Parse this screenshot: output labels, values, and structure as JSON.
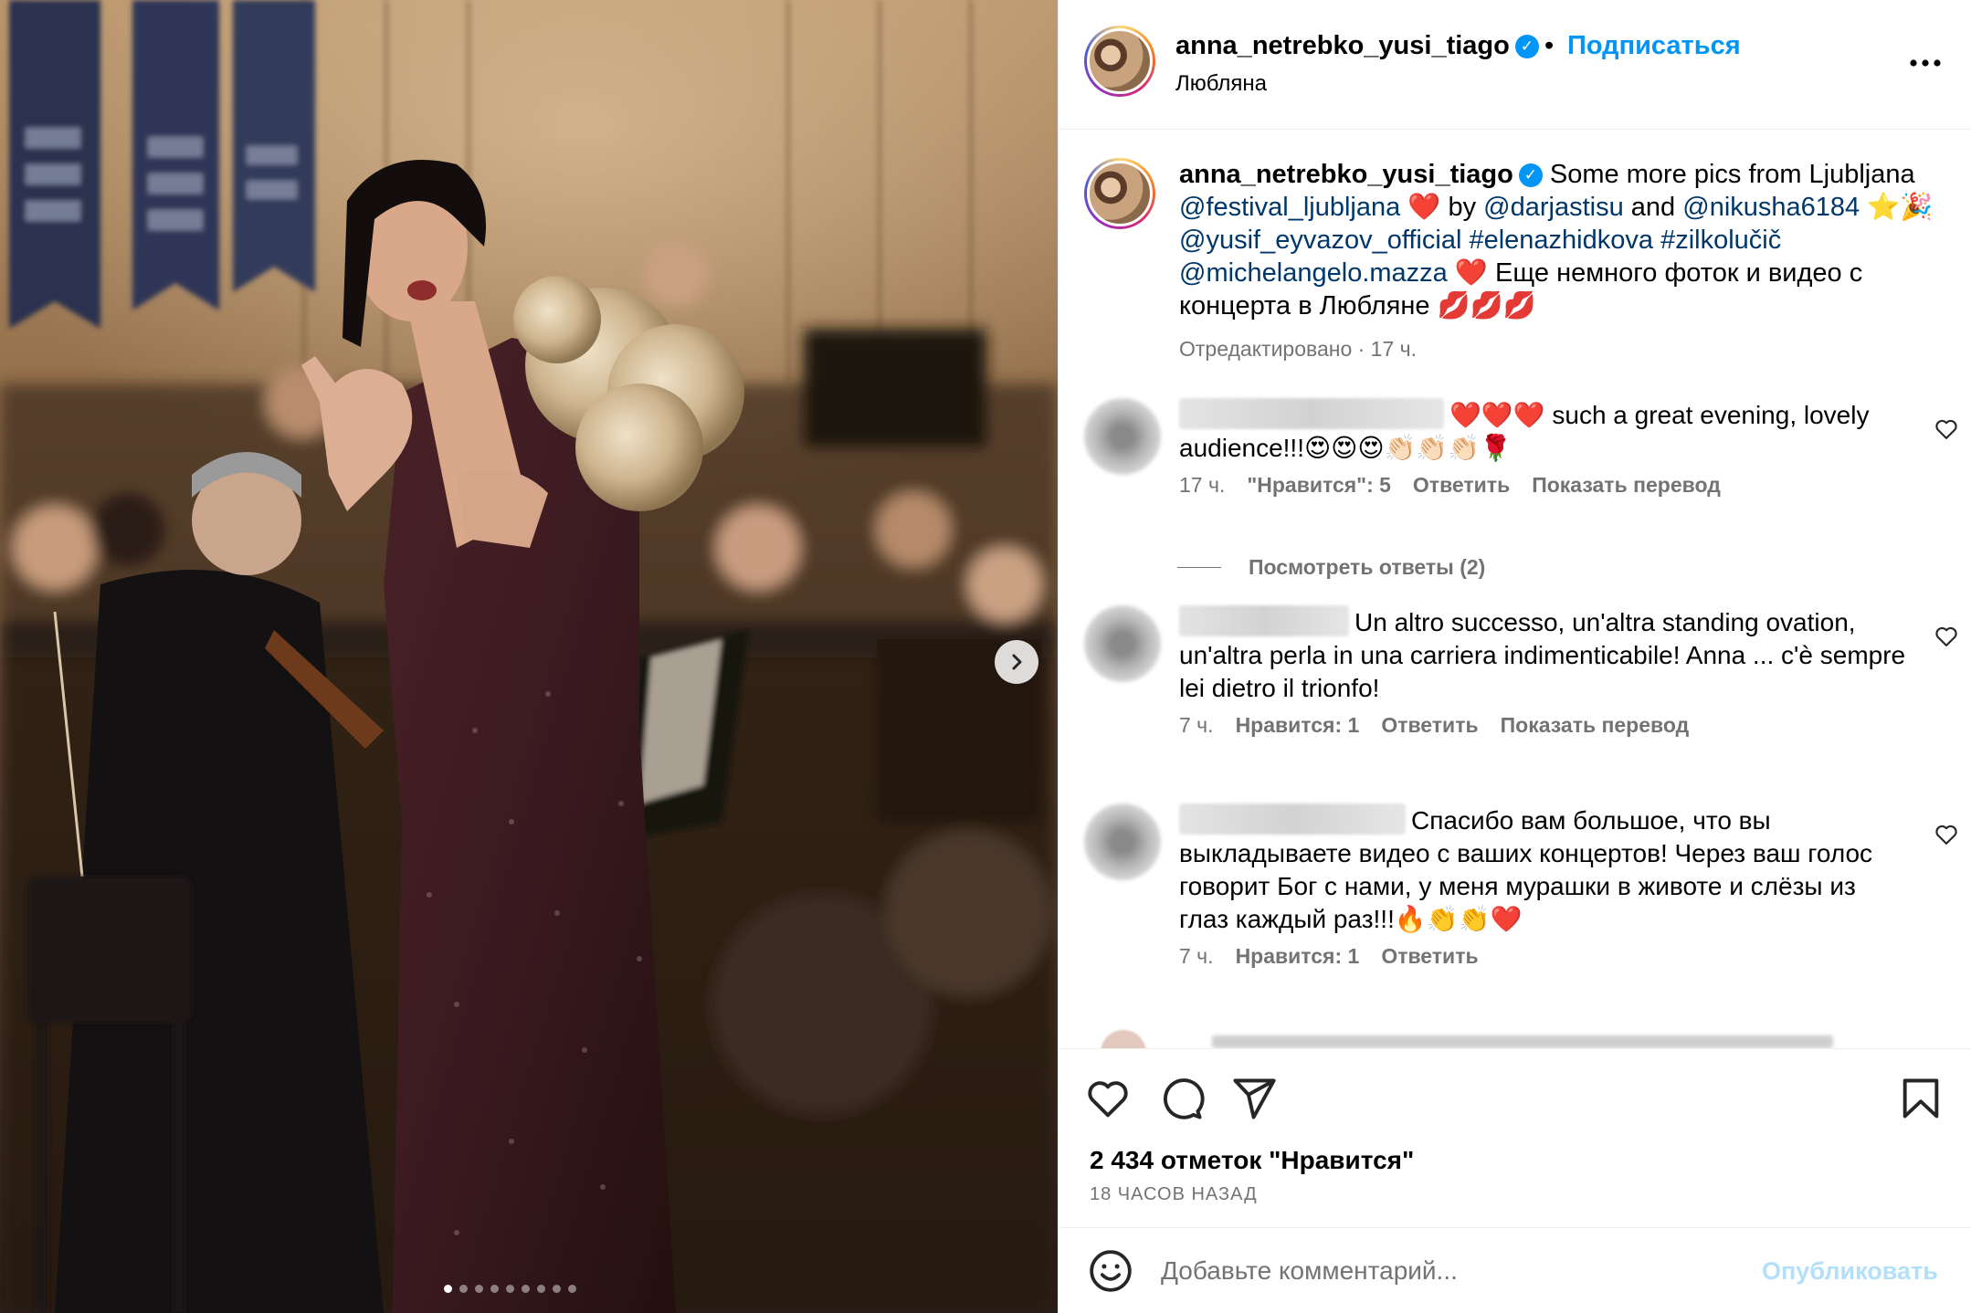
{
  "post": {
    "username": "anna_netrebko_yusi_tiago",
    "separator": "•",
    "follow_label": "Подписаться",
    "location": "Любляна",
    "verified_mark": "✓"
  },
  "media": {
    "carousel_total": 9,
    "carousel_index": 1,
    "next_icon": "chevron-right-icon"
  },
  "caption": {
    "username": "anna_netrebko_yusi_tiago",
    "parts": {
      "p1": "Some more pics from Ljubljana",
      "m1": "@festival_ljubljana",
      "p2": "❤️ by",
      "m2": "@darjastisu",
      "p3": "and",
      "m3": "@nikusha6184",
      "p4": "⭐🎉",
      "m4": "@yusif_eyvazov_official",
      "h1": "#elenazhidkova",
      "h2": "#zilkolučič",
      "m5": "@michelangelo.mazza",
      "p5": "❤️ Еще немного фоток и видео с концерта в Любляне 💋💋💋"
    },
    "meta": "Отредактировано · 17 ч."
  },
  "comments": [
    {
      "text": "❤️❤️❤️ such a great evening, lovely audience!!!😍😍😍👏🏻👏🏻👏🏻🌹",
      "time": "17 ч.",
      "likes": "\"Нравится\": 5",
      "reply": "Ответить",
      "translate": "Показать перевод"
    },
    {
      "text": "Un altro successo, un'altra standing ovation, un'altra perla in una carriera indimenticabile! Anna ... c'è sempre lei dietro il trionfo!",
      "time": "7 ч.",
      "likes": "Нравится: 1",
      "reply": "Ответить",
      "translate": "Показать перевод"
    },
    {
      "text": "Спасибо вам большое, что вы выкладываете видео с ваших концертов! Через ваш голос говорит Бог с нами, у меня мурашки в животе и слёзы из глаз каждый раз!!!🔥👏👏❤️",
      "time": "7 ч.",
      "likes": "Нравится: 1",
      "reply": "Ответить"
    }
  ],
  "view_replies": "Посмотреть ответы (2)",
  "actions": {
    "icons": [
      "heart-icon",
      "comment-icon",
      "share-icon",
      "bookmark-icon"
    ],
    "likes_count": "2 434 отметок \"Нравится\"",
    "posted_ago": "18 ЧАСОВ НАЗАД"
  },
  "composer": {
    "placeholder": "Добавьте комментарий...",
    "publish_label": "Опубликовать",
    "emoji_icon": "smiley-icon"
  },
  "colors": {
    "link": "#0095f6",
    "mention": "#00376b",
    "secondary_text": "#737373",
    "publish_disabled": "#b2dffc"
  }
}
